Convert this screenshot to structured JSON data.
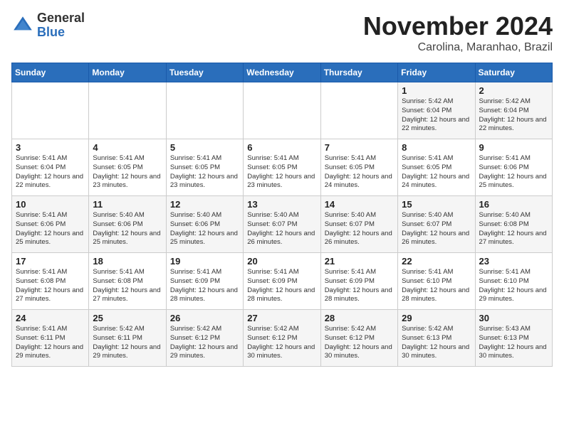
{
  "header": {
    "logo_line1": "General",
    "logo_line2": "Blue",
    "month": "November 2024",
    "location": "Carolina, Maranhao, Brazil"
  },
  "weekdays": [
    "Sunday",
    "Monday",
    "Tuesday",
    "Wednesday",
    "Thursday",
    "Friday",
    "Saturday"
  ],
  "weeks": [
    [
      {
        "day": "",
        "info": ""
      },
      {
        "day": "",
        "info": ""
      },
      {
        "day": "",
        "info": ""
      },
      {
        "day": "",
        "info": ""
      },
      {
        "day": "",
        "info": ""
      },
      {
        "day": "1",
        "info": "Sunrise: 5:42 AM\nSunset: 6:04 PM\nDaylight: 12 hours and 22 minutes."
      },
      {
        "day": "2",
        "info": "Sunrise: 5:42 AM\nSunset: 6:04 PM\nDaylight: 12 hours and 22 minutes."
      }
    ],
    [
      {
        "day": "3",
        "info": "Sunrise: 5:41 AM\nSunset: 6:04 PM\nDaylight: 12 hours and 22 minutes."
      },
      {
        "day": "4",
        "info": "Sunrise: 5:41 AM\nSunset: 6:05 PM\nDaylight: 12 hours and 23 minutes."
      },
      {
        "day": "5",
        "info": "Sunrise: 5:41 AM\nSunset: 6:05 PM\nDaylight: 12 hours and 23 minutes."
      },
      {
        "day": "6",
        "info": "Sunrise: 5:41 AM\nSunset: 6:05 PM\nDaylight: 12 hours and 23 minutes."
      },
      {
        "day": "7",
        "info": "Sunrise: 5:41 AM\nSunset: 6:05 PM\nDaylight: 12 hours and 24 minutes."
      },
      {
        "day": "8",
        "info": "Sunrise: 5:41 AM\nSunset: 6:05 PM\nDaylight: 12 hours and 24 minutes."
      },
      {
        "day": "9",
        "info": "Sunrise: 5:41 AM\nSunset: 6:06 PM\nDaylight: 12 hours and 25 minutes."
      }
    ],
    [
      {
        "day": "10",
        "info": "Sunrise: 5:41 AM\nSunset: 6:06 PM\nDaylight: 12 hours and 25 minutes."
      },
      {
        "day": "11",
        "info": "Sunrise: 5:40 AM\nSunset: 6:06 PM\nDaylight: 12 hours and 25 minutes."
      },
      {
        "day": "12",
        "info": "Sunrise: 5:40 AM\nSunset: 6:06 PM\nDaylight: 12 hours and 25 minutes."
      },
      {
        "day": "13",
        "info": "Sunrise: 5:40 AM\nSunset: 6:07 PM\nDaylight: 12 hours and 26 minutes."
      },
      {
        "day": "14",
        "info": "Sunrise: 5:40 AM\nSunset: 6:07 PM\nDaylight: 12 hours and 26 minutes."
      },
      {
        "day": "15",
        "info": "Sunrise: 5:40 AM\nSunset: 6:07 PM\nDaylight: 12 hours and 26 minutes."
      },
      {
        "day": "16",
        "info": "Sunrise: 5:40 AM\nSunset: 6:08 PM\nDaylight: 12 hours and 27 minutes."
      }
    ],
    [
      {
        "day": "17",
        "info": "Sunrise: 5:41 AM\nSunset: 6:08 PM\nDaylight: 12 hours and 27 minutes."
      },
      {
        "day": "18",
        "info": "Sunrise: 5:41 AM\nSunset: 6:08 PM\nDaylight: 12 hours and 27 minutes."
      },
      {
        "day": "19",
        "info": "Sunrise: 5:41 AM\nSunset: 6:09 PM\nDaylight: 12 hours and 28 minutes."
      },
      {
        "day": "20",
        "info": "Sunrise: 5:41 AM\nSunset: 6:09 PM\nDaylight: 12 hours and 28 minutes."
      },
      {
        "day": "21",
        "info": "Sunrise: 5:41 AM\nSunset: 6:09 PM\nDaylight: 12 hours and 28 minutes."
      },
      {
        "day": "22",
        "info": "Sunrise: 5:41 AM\nSunset: 6:10 PM\nDaylight: 12 hours and 28 minutes."
      },
      {
        "day": "23",
        "info": "Sunrise: 5:41 AM\nSunset: 6:10 PM\nDaylight: 12 hours and 29 minutes."
      }
    ],
    [
      {
        "day": "24",
        "info": "Sunrise: 5:41 AM\nSunset: 6:11 PM\nDaylight: 12 hours and 29 minutes."
      },
      {
        "day": "25",
        "info": "Sunrise: 5:42 AM\nSunset: 6:11 PM\nDaylight: 12 hours and 29 minutes."
      },
      {
        "day": "26",
        "info": "Sunrise: 5:42 AM\nSunset: 6:12 PM\nDaylight: 12 hours and 29 minutes."
      },
      {
        "day": "27",
        "info": "Sunrise: 5:42 AM\nSunset: 6:12 PM\nDaylight: 12 hours and 30 minutes."
      },
      {
        "day": "28",
        "info": "Sunrise: 5:42 AM\nSunset: 6:12 PM\nDaylight: 12 hours and 30 minutes."
      },
      {
        "day": "29",
        "info": "Sunrise: 5:42 AM\nSunset: 6:13 PM\nDaylight: 12 hours and 30 minutes."
      },
      {
        "day": "30",
        "info": "Sunrise: 5:43 AM\nSunset: 6:13 PM\nDaylight: 12 hours and 30 minutes."
      }
    ]
  ]
}
